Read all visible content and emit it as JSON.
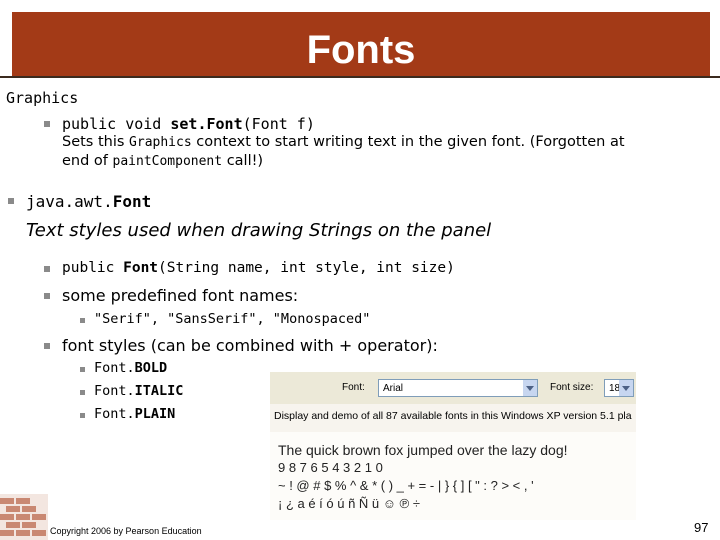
{
  "title": "Fonts",
  "section_label": "Graphics",
  "setfont": {
    "prefix": "public void ",
    "method": "set.Font",
    "params": "(Font f)",
    "desc_1": "Sets this ",
    "desc_code_1": "Graphics",
    "desc_2": " context to start writing text in the given font.  (Forgotten at",
    "desc_3": "end of ",
    "desc_code_2": "paintComponent",
    "desc_4": " call!)"
  },
  "font_class": {
    "pkg": "java.awt.",
    "name": "Font"
  },
  "tagline": "Text styles used when drawing Strings on the panel",
  "ctor": {
    "prefix": "public ",
    "name": "Font",
    "params": "(String name, int style, int size)"
  },
  "names_label": "some predefined font names:",
  "names_list": "\"Serif\", \"SansSerif\", \"Monospaced\"",
  "styles_label": "font styles (can be combined with + operator):",
  "styles": [
    {
      "prefix": "Font.",
      "name": "BOLD"
    },
    {
      "prefix": "Font.",
      "name": "ITALIC"
    },
    {
      "prefix": "Font.",
      "name": "PLAIN"
    }
  ],
  "screenshot": {
    "font_label": "Font:",
    "font_value": "Arial",
    "size_label": "Font size:",
    "size_value": "18",
    "description": "Display and demo of all 87 available fonts in this Windows XP version 5.1 pla",
    "demo_lines": [
      "The quick brown fox jumped over the lazy dog!",
      "9 8 7 6 5 4 3 2 1 0",
      "~ ! @ # $ % ^ & * ( ) _ + = - | } { ] [ \" : ? > < , '",
      "¡ ¿ a é í ó ú ñ Ñ ü ☺ ℗ ÷"
    ]
  },
  "footer": "Copyright 2006 by Pearson Education",
  "page_number": "97"
}
